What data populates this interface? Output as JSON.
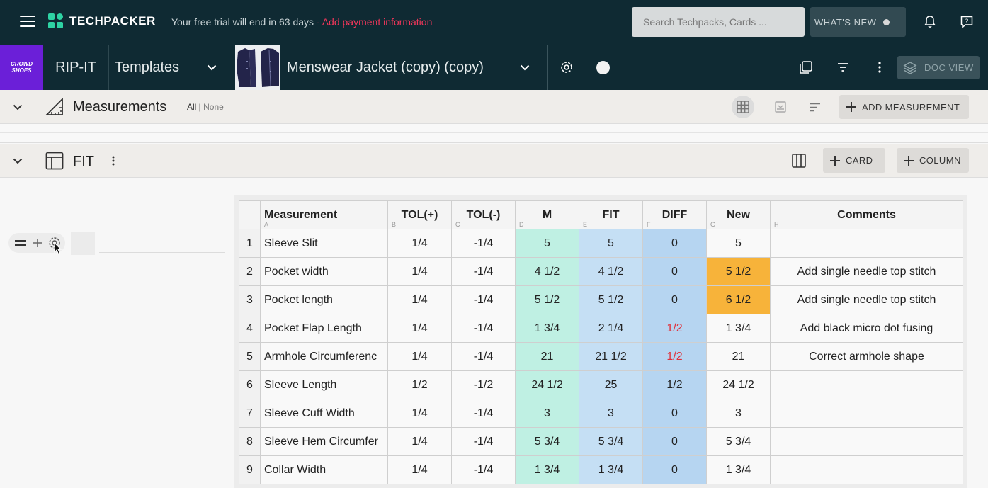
{
  "topbar": {
    "logo_text": "TECHPACKER",
    "trial_text": "Your free trial will end in 63 days",
    "trial_link": " - Add payment information",
    "search_placeholder": "Search Techpacks, Cards ...",
    "whats_new": "WHAT'S NEW"
  },
  "subbar": {
    "brand_tile_line1": "CROWD",
    "brand_tile_line2": "SHOES",
    "company": "RIP-IT",
    "folder": "Templates",
    "doc_title": "Menswear Jacket (copy) (copy)",
    "doc_view": "DOC VIEW"
  },
  "measurements": {
    "title": "Measurements",
    "all": "All",
    "sep": " | ",
    "none": "None",
    "add_button": "ADD MEASUREMENT"
  },
  "fit": {
    "title": "FIT",
    "card_button": "CARD",
    "column_button": "COLUMN"
  },
  "table": {
    "columns": [
      {
        "label": "Measurement",
        "letter": "A"
      },
      {
        "label": "TOL(+)",
        "letter": "B"
      },
      {
        "label": "TOL(-)",
        "letter": "C"
      },
      {
        "label": "M",
        "letter": "D"
      },
      {
        "label": "FIT",
        "letter": "E"
      },
      {
        "label": "DIFF",
        "letter": "F"
      },
      {
        "label": "New",
        "letter": "G"
      },
      {
        "label": "Comments",
        "letter": "H"
      }
    ],
    "rows": [
      {
        "n": "1",
        "name": "Sleeve Slit",
        "tp": "1/4",
        "tm": "-1/4",
        "m": "5",
        "fit": "5",
        "diff": "0",
        "new": "5",
        "comment": ""
      },
      {
        "n": "2",
        "name": "Pocket width",
        "tp": "1/4",
        "tm": "-1/4",
        "m": "4 1/2",
        "fit": "4 1/2",
        "diff": "0",
        "new": "5 1/2",
        "comment": "Add single needle top stitch"
      },
      {
        "n": "3",
        "name": "Pocket length",
        "tp": "1/4",
        "tm": "-1/4",
        "m": "5 1/2",
        "fit": "5 1/2",
        "diff": "0",
        "new": "6 1/2",
        "comment": "Add single needle top stitch"
      },
      {
        "n": "4",
        "name": "Pocket Flap Length",
        "tp": "1/4",
        "tm": "-1/4",
        "m": "1 3/4",
        "fit": "2 1/4",
        "diff": "1/2",
        "new": "1 3/4",
        "comment": "Add black micro dot fusing"
      },
      {
        "n": "5",
        "name": "Armhole Circumferenc",
        "tp": "1/4",
        "tm": "-1/4",
        "m": "21",
        "fit": "21 1/2",
        "diff": "1/2",
        "new": "21",
        "comment": "Correct armhole shape"
      },
      {
        "n": "6",
        "name": "Sleeve Length",
        "tp": "1/2",
        "tm": "-1/2",
        "m": "24 1/2",
        "fit": "25",
        "diff": "1/2",
        "new": "24 1/2",
        "comment": ""
      },
      {
        "n": "7",
        "name": "Sleeve Cuff Width",
        "tp": "1/4",
        "tm": "-1/4",
        "m": "3",
        "fit": "3",
        "diff": "0",
        "new": "3",
        "comment": ""
      },
      {
        "n": "8",
        "name": "Sleeve Hem Circumfer",
        "tp": "1/4",
        "tm": "-1/4",
        "m": "5 3/4",
        "fit": "5 3/4",
        "diff": "0",
        "new": "5 3/4",
        "comment": ""
      },
      {
        "n": "9",
        "name": "Collar Width",
        "tp": "1/4",
        "tm": "-1/4",
        "m": "1 3/4",
        "fit": "1 3/4",
        "diff": "0",
        "new": "1 3/4",
        "comment": ""
      }
    ],
    "red_diff_rows": [
      3,
      4
    ],
    "orange_new_rows": [
      1,
      2
    ]
  },
  "colors": {
    "topbar_bg": "#0f2a33",
    "brand_purple": "#6b1fd8",
    "link_red": "#f0365a",
    "logo_green": "#2ed3a4",
    "m_col": "#bff0e3",
    "fit_col": "#c5dff4",
    "diff_col": "#b6d5f1",
    "new_highlight": "#f7b33a"
  },
  "icons": [
    "hamburger-icon",
    "techpacker-logo-icon",
    "bell-icon",
    "help-icon",
    "chevron-down-icon",
    "gear-icon",
    "copy-icon",
    "filter-icon",
    "more-vertical-icon",
    "layers-icon",
    "ruler-triangle-icon",
    "grid-icon",
    "import-icon",
    "sort-icon",
    "plus-icon",
    "table-layout-icon",
    "columns-icon",
    "drag-handle-icon",
    "target-icon"
  ]
}
